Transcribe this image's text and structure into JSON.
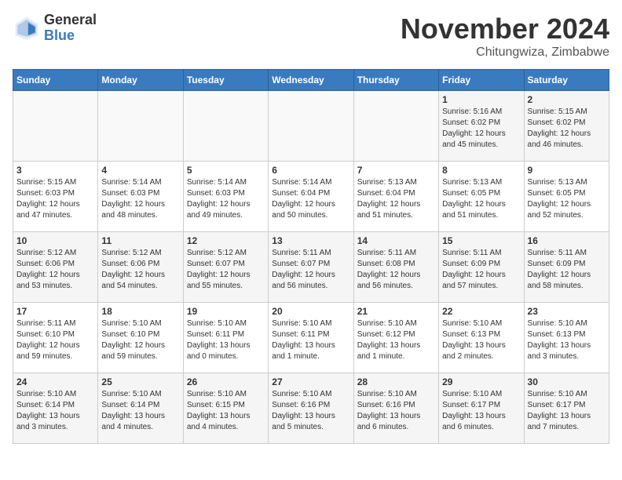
{
  "logo": {
    "general": "General",
    "blue": "Blue"
  },
  "title": "November 2024",
  "location": "Chitungwiza, Zimbabwe",
  "days_of_week": [
    "Sunday",
    "Monday",
    "Tuesday",
    "Wednesday",
    "Thursday",
    "Friday",
    "Saturday"
  ],
  "weeks": [
    [
      {
        "day": "",
        "info": ""
      },
      {
        "day": "",
        "info": ""
      },
      {
        "day": "",
        "info": ""
      },
      {
        "day": "",
        "info": ""
      },
      {
        "day": "",
        "info": ""
      },
      {
        "day": "1",
        "info": "Sunrise: 5:16 AM\nSunset: 6:02 PM\nDaylight: 12 hours\nand 45 minutes."
      },
      {
        "day": "2",
        "info": "Sunrise: 5:15 AM\nSunset: 6:02 PM\nDaylight: 12 hours\nand 46 minutes."
      }
    ],
    [
      {
        "day": "3",
        "info": "Sunrise: 5:15 AM\nSunset: 6:03 PM\nDaylight: 12 hours\nand 47 minutes."
      },
      {
        "day": "4",
        "info": "Sunrise: 5:14 AM\nSunset: 6:03 PM\nDaylight: 12 hours\nand 48 minutes."
      },
      {
        "day": "5",
        "info": "Sunrise: 5:14 AM\nSunset: 6:03 PM\nDaylight: 12 hours\nand 49 minutes."
      },
      {
        "day": "6",
        "info": "Sunrise: 5:14 AM\nSunset: 6:04 PM\nDaylight: 12 hours\nand 50 minutes."
      },
      {
        "day": "7",
        "info": "Sunrise: 5:13 AM\nSunset: 6:04 PM\nDaylight: 12 hours\nand 51 minutes."
      },
      {
        "day": "8",
        "info": "Sunrise: 5:13 AM\nSunset: 6:05 PM\nDaylight: 12 hours\nand 51 minutes."
      },
      {
        "day": "9",
        "info": "Sunrise: 5:13 AM\nSunset: 6:05 PM\nDaylight: 12 hours\nand 52 minutes."
      }
    ],
    [
      {
        "day": "10",
        "info": "Sunrise: 5:12 AM\nSunset: 6:06 PM\nDaylight: 12 hours\nand 53 minutes."
      },
      {
        "day": "11",
        "info": "Sunrise: 5:12 AM\nSunset: 6:06 PM\nDaylight: 12 hours\nand 54 minutes."
      },
      {
        "day": "12",
        "info": "Sunrise: 5:12 AM\nSunset: 6:07 PM\nDaylight: 12 hours\nand 55 minutes."
      },
      {
        "day": "13",
        "info": "Sunrise: 5:11 AM\nSunset: 6:07 PM\nDaylight: 12 hours\nand 56 minutes."
      },
      {
        "day": "14",
        "info": "Sunrise: 5:11 AM\nSunset: 6:08 PM\nDaylight: 12 hours\nand 56 minutes."
      },
      {
        "day": "15",
        "info": "Sunrise: 5:11 AM\nSunset: 6:09 PM\nDaylight: 12 hours\nand 57 minutes."
      },
      {
        "day": "16",
        "info": "Sunrise: 5:11 AM\nSunset: 6:09 PM\nDaylight: 12 hours\nand 58 minutes."
      }
    ],
    [
      {
        "day": "17",
        "info": "Sunrise: 5:11 AM\nSunset: 6:10 PM\nDaylight: 12 hours\nand 59 minutes."
      },
      {
        "day": "18",
        "info": "Sunrise: 5:10 AM\nSunset: 6:10 PM\nDaylight: 12 hours\nand 59 minutes."
      },
      {
        "day": "19",
        "info": "Sunrise: 5:10 AM\nSunset: 6:11 PM\nDaylight: 13 hours\nand 0 minutes."
      },
      {
        "day": "20",
        "info": "Sunrise: 5:10 AM\nSunset: 6:11 PM\nDaylight: 13 hours\nand 1 minute."
      },
      {
        "day": "21",
        "info": "Sunrise: 5:10 AM\nSunset: 6:12 PM\nDaylight: 13 hours\nand 1 minute."
      },
      {
        "day": "22",
        "info": "Sunrise: 5:10 AM\nSunset: 6:13 PM\nDaylight: 13 hours\nand 2 minutes."
      },
      {
        "day": "23",
        "info": "Sunrise: 5:10 AM\nSunset: 6:13 PM\nDaylight: 13 hours\nand 3 minutes."
      }
    ],
    [
      {
        "day": "24",
        "info": "Sunrise: 5:10 AM\nSunset: 6:14 PM\nDaylight: 13 hours\nand 3 minutes."
      },
      {
        "day": "25",
        "info": "Sunrise: 5:10 AM\nSunset: 6:14 PM\nDaylight: 13 hours\nand 4 minutes."
      },
      {
        "day": "26",
        "info": "Sunrise: 5:10 AM\nSunset: 6:15 PM\nDaylight: 13 hours\nand 4 minutes."
      },
      {
        "day": "27",
        "info": "Sunrise: 5:10 AM\nSunset: 6:16 PM\nDaylight: 13 hours\nand 5 minutes."
      },
      {
        "day": "28",
        "info": "Sunrise: 5:10 AM\nSunset: 6:16 PM\nDaylight: 13 hours\nand 6 minutes."
      },
      {
        "day": "29",
        "info": "Sunrise: 5:10 AM\nSunset: 6:17 PM\nDaylight: 13 hours\nand 6 minutes."
      },
      {
        "day": "30",
        "info": "Sunrise: 5:10 AM\nSunset: 6:17 PM\nDaylight: 13 hours\nand 7 minutes."
      }
    ]
  ]
}
